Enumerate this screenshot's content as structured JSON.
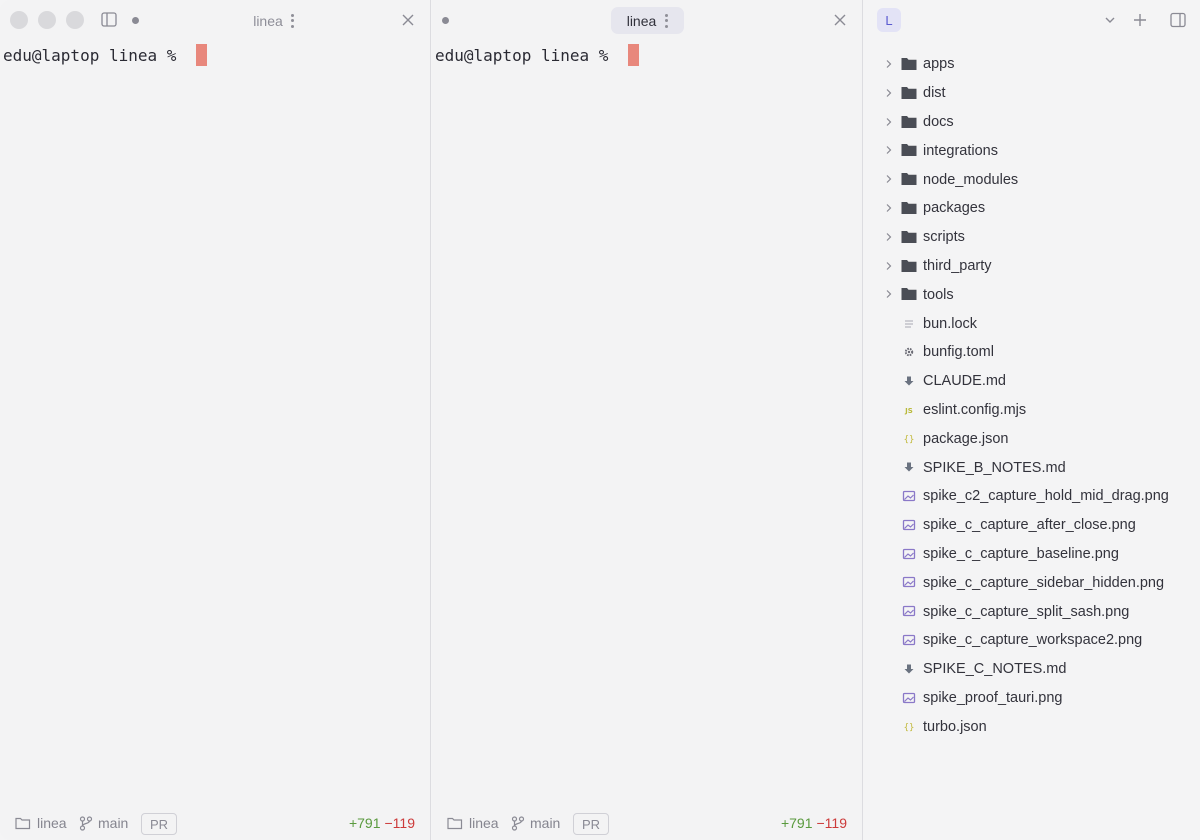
{
  "panes": [
    {
      "tab_label": "linea",
      "prompt": "edu@laptop linea % ",
      "status": {
        "folder": "linea",
        "branch": "main",
        "pr": "PR",
        "added": "+791",
        "removed": "−119"
      }
    },
    {
      "tab_label": "linea",
      "prompt": "edu@laptop linea % ",
      "status": {
        "folder": "linea",
        "branch": "main",
        "pr": "PR",
        "added": "+791",
        "removed": "−119"
      }
    }
  ],
  "explorer": {
    "workspace_initial": "L",
    "folders": [
      "apps",
      "dist",
      "docs",
      "integrations",
      "node_modules",
      "packages",
      "scripts",
      "third_party",
      "tools"
    ],
    "files": [
      {
        "name": "bun.lock",
        "icon": "lines-file-icon"
      },
      {
        "name": "bunfig.toml",
        "icon": "gear-file-icon"
      },
      {
        "name": "CLAUDE.md",
        "icon": "markdown-file-icon"
      },
      {
        "name": "eslint.config.mjs",
        "icon": "js-file-icon"
      },
      {
        "name": "package.json",
        "icon": "json-file-icon"
      },
      {
        "name": "SPIKE_B_NOTES.md",
        "icon": "markdown-file-icon"
      },
      {
        "name": "spike_c2_capture_hold_mid_drag.png",
        "icon": "image-file-icon"
      },
      {
        "name": "spike_c_capture_after_close.png",
        "icon": "image-file-icon"
      },
      {
        "name": "spike_c_capture_baseline.png",
        "icon": "image-file-icon"
      },
      {
        "name": "spike_c_capture_sidebar_hidden.png",
        "icon": "image-file-icon"
      },
      {
        "name": "spike_c_capture_split_sash.png",
        "icon": "image-file-icon"
      },
      {
        "name": "spike_c_capture_workspace2.png",
        "icon": "image-file-icon"
      },
      {
        "name": "SPIKE_C_NOTES.md",
        "icon": "markdown-file-icon"
      },
      {
        "name": "spike_proof_tauri.png",
        "icon": "image-file-icon"
      },
      {
        "name": "turbo.json",
        "icon": "json-file-icon"
      }
    ]
  },
  "colors": {
    "cursor": "#e8877c",
    "added": "#5a9a3e",
    "removed": "#cc3a3a",
    "folder": "#4a4d55",
    "accent": "#5a5ad0"
  }
}
